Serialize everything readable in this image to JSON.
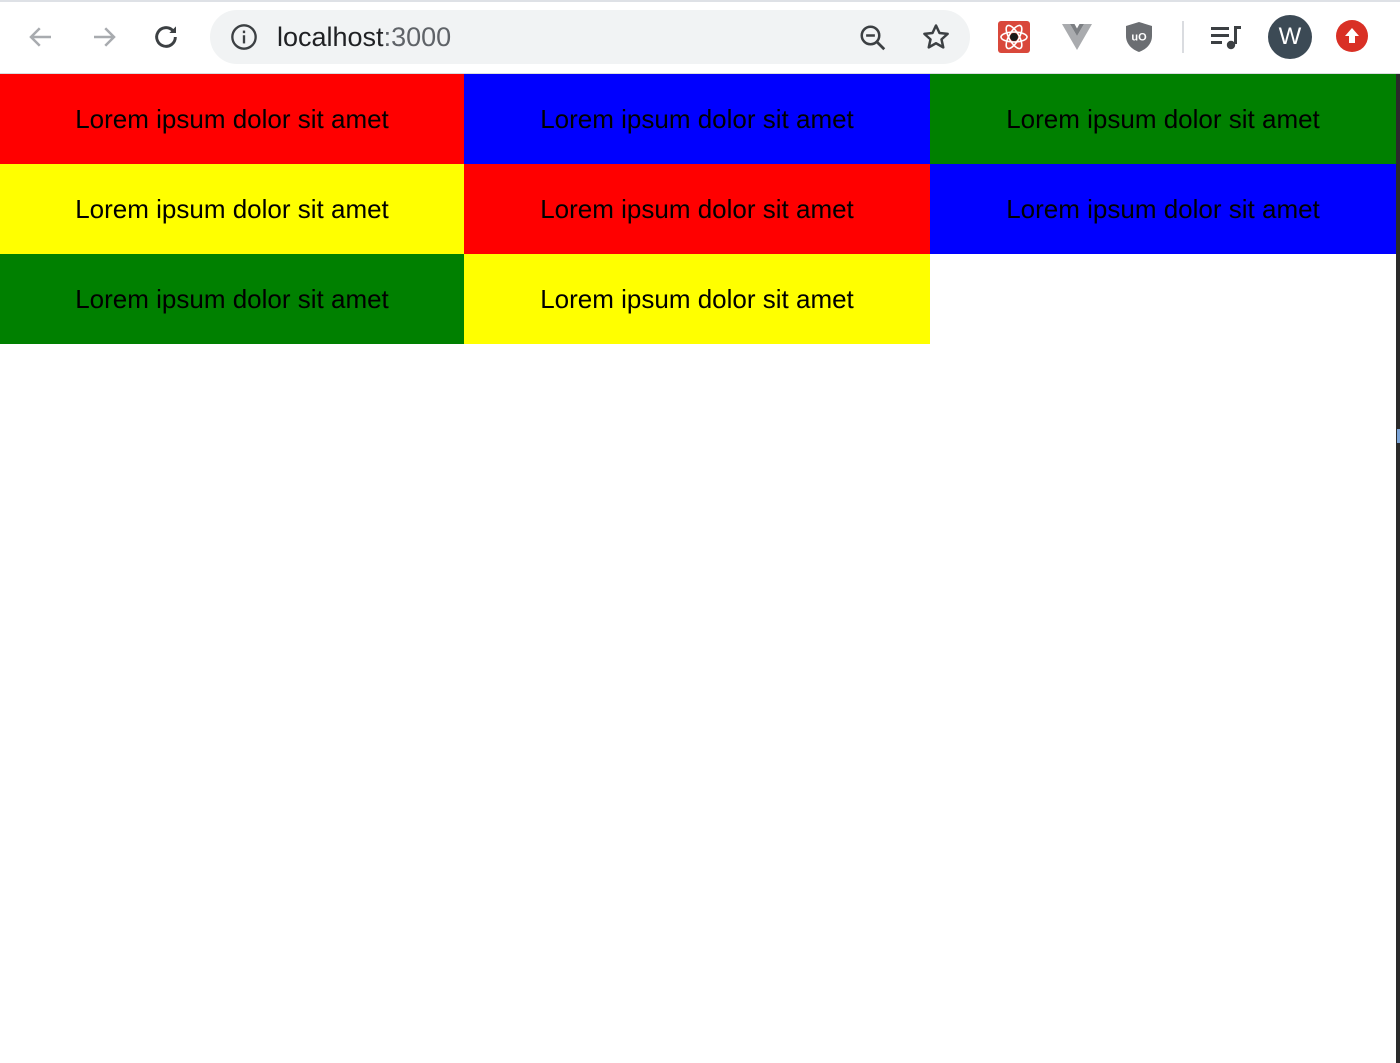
{
  "browser": {
    "url_host": "localhost",
    "url_port": ":3000",
    "profile_initial": "W",
    "icons": {
      "back": "arrow-left-icon",
      "forward": "arrow-right-icon",
      "reload": "reload-icon",
      "info": "info-icon",
      "zoom": "zoom-out-icon",
      "bookmark": "star-icon",
      "react_devtools": "react-devtools-icon",
      "vue_devtools": "vue-devtools-icon",
      "ublock": "ublock-icon",
      "media": "media-queue-icon",
      "update": "update-arrow-icon"
    }
  },
  "page": {
    "cells": [
      {
        "text": "Lorem ipsum dolor sit amet",
        "color": "#ff0000"
      },
      {
        "text": "Lorem ipsum dolor sit amet",
        "color": "#0000ff"
      },
      {
        "text": "Lorem ipsum dolor sit amet",
        "color": "#008000"
      },
      {
        "text": "Lorem ipsum dolor sit amet",
        "color": "#ffff00"
      },
      {
        "text": "Lorem ipsum dolor sit amet",
        "color": "#ff0000"
      },
      {
        "text": "Lorem ipsum dolor sit amet",
        "color": "#0000ff"
      },
      {
        "text": "Lorem ipsum dolor sit amet",
        "color": "#008000"
      },
      {
        "text": "Lorem ipsum dolor sit amet",
        "color": "#ffff00"
      }
    ]
  }
}
